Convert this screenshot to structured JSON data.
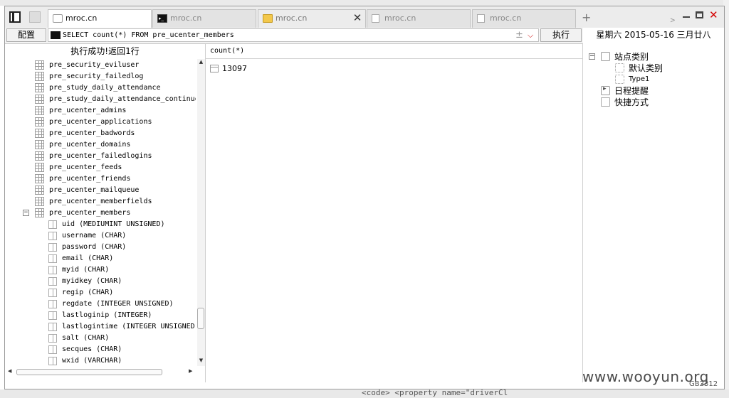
{
  "tabs": [
    {
      "label": "mroc.cn",
      "icon": "page-icon",
      "active": true
    },
    {
      "label": "mroc.cn",
      "icon": "terminal-icon",
      "active": false
    },
    {
      "label": "mroc.cn",
      "icon": "folder-icon",
      "active": false
    },
    {
      "label": "mroc.cn",
      "icon": "document-icon",
      "active": false
    },
    {
      "label": "mroc.cn",
      "icon": "document-icon",
      "active": false
    }
  ],
  "tab_controls": {
    "add": "+",
    "next": "﹥",
    "close": "✕"
  },
  "toolbar": {
    "config_label": "配置",
    "query_value": "SELECT count(*) FROM pre_ucenter_members",
    "pin_icon": "±",
    "dropdown_icon": "⌵",
    "execute_label": "执行"
  },
  "left_panel": {
    "status": "执行成功!返回1行",
    "tables": [
      "pre_security_eviluser",
      "pre_security_failedlog",
      "pre_study_daily_attendance",
      "pre_study_daily_attendance_continuous",
      "pre_ucenter_admins",
      "pre_ucenter_applications",
      "pre_ucenter_badwords",
      "pre_ucenter_domains",
      "pre_ucenter_failedlogins",
      "pre_ucenter_feeds",
      "pre_ucenter_friends",
      "pre_ucenter_mailqueue",
      "pre_ucenter_memberfields"
    ],
    "expanded_table": {
      "name": "pre_ucenter_members",
      "toggle": "−"
    },
    "columns": [
      "uid (MEDIUMINT UNSIGNED)",
      "username (CHAR)",
      "password (CHAR)",
      "email (CHAR)",
      "myid (CHAR)",
      "myidkey (CHAR)",
      "regip (CHAR)",
      "regdate (INTEGER UNSIGNED)",
      "lastloginip (INTEGER)",
      "lastlogintime (INTEGER UNSIGNED)",
      "salt (CHAR)",
      "secques (CHAR)",
      "wxid (VARCHAR)"
    ],
    "scroll": {
      "up": "▲",
      "down": "▼",
      "left": "◀",
      "right": "▶"
    }
  },
  "result": {
    "column_header": "count(*)",
    "value": "13097"
  },
  "right_panel": {
    "date": "星期六 2015-05-16 三月廿八",
    "site_category": {
      "label": "站点类别",
      "toggle": "−"
    },
    "sub_items": [
      "默认类别",
      "Type1"
    ],
    "schedule_label": "日程提醒",
    "shortcut_label": "快捷方式"
  },
  "watermark": "www.wooyun.org",
  "encoding": "GB2312",
  "background_snippet": "<code>      <property name=\"driverCl"
}
